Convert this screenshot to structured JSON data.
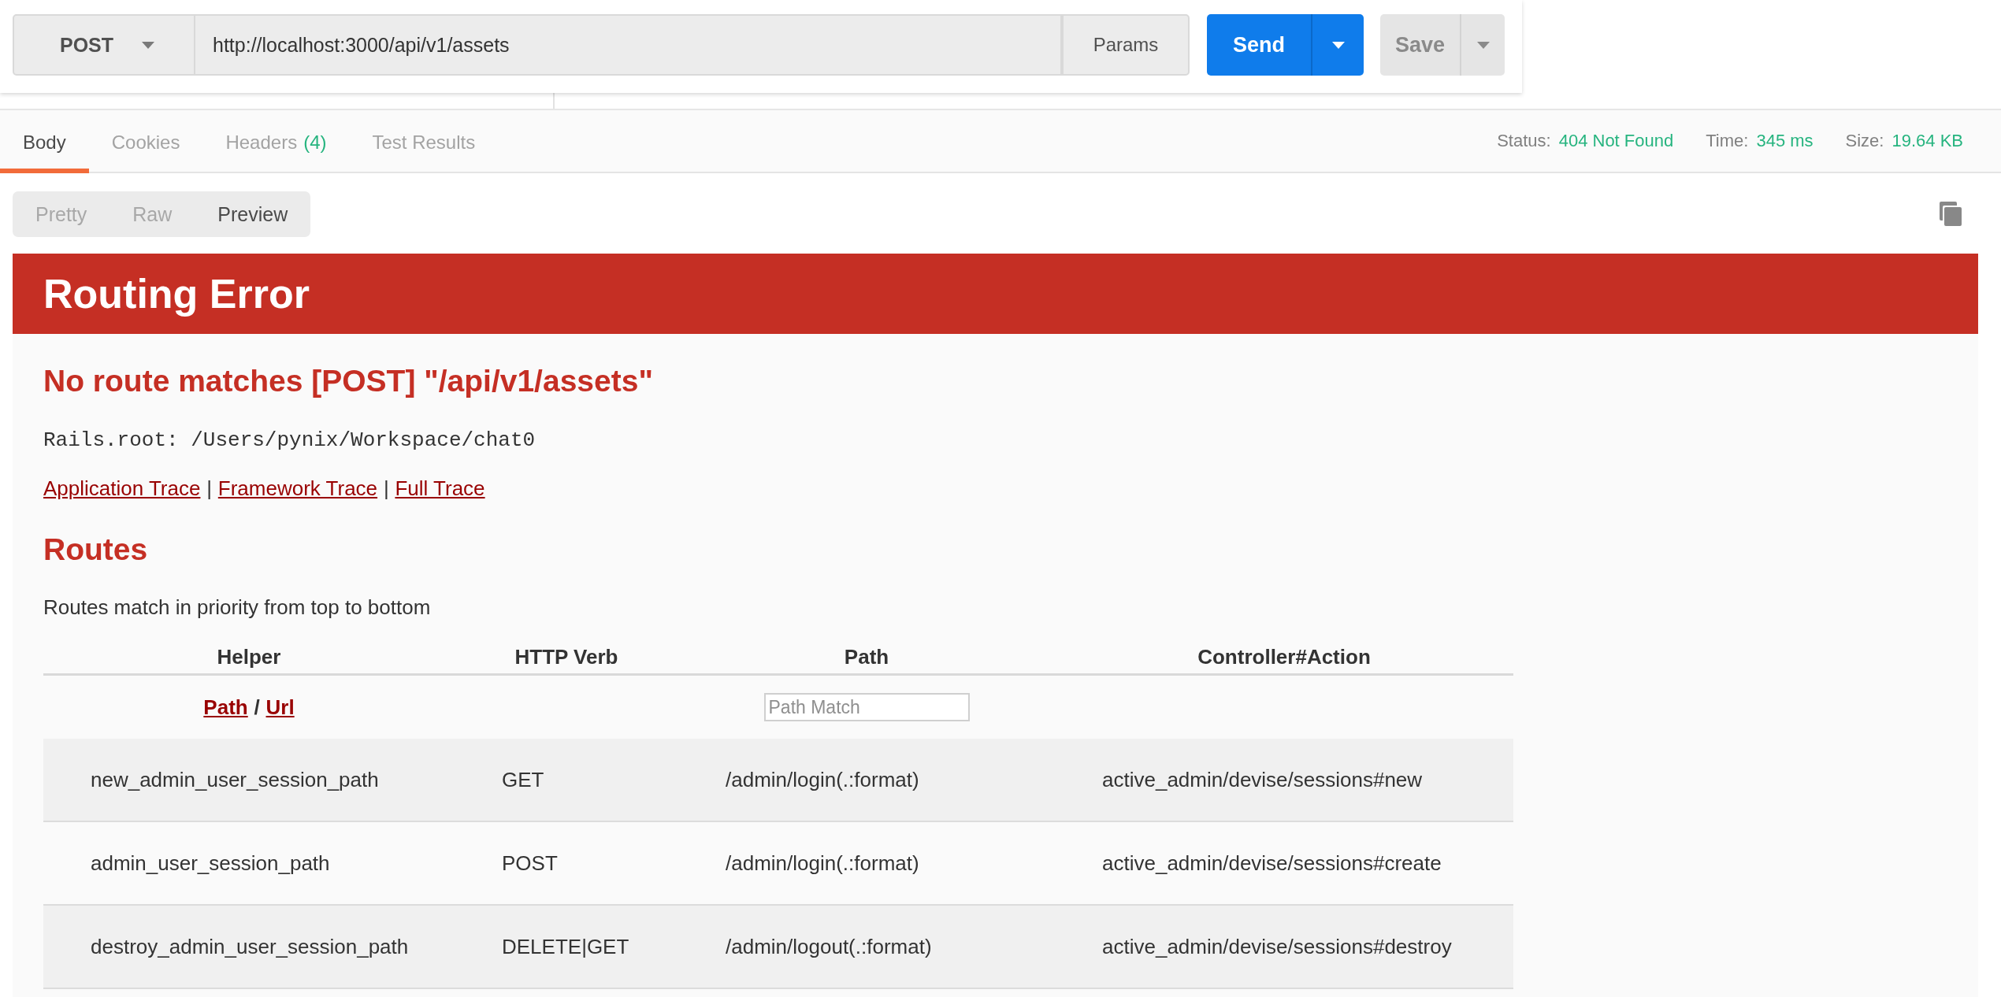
{
  "request": {
    "method": "POST",
    "url": "http://localhost:3000/api/v1/assets",
    "params": "Params",
    "send": "Send",
    "save": "Save"
  },
  "response_tabs": [
    {
      "label": "Body",
      "selected": true
    },
    {
      "label": "Cookies",
      "selected": false
    },
    {
      "label": "Headers",
      "count": "(4)",
      "selected": false
    },
    {
      "label": "Test Results",
      "selected": false
    }
  ],
  "status": [
    {
      "label": "Status:",
      "value": "404 Not Found"
    },
    {
      "label": "Time:",
      "value": "345 ms"
    },
    {
      "label": "Size:",
      "value": "19.64 KB"
    }
  ],
  "view_modes": [
    {
      "label": "Pretty",
      "selected": false
    },
    {
      "label": "Raw",
      "selected": false
    },
    {
      "label": "Preview",
      "selected": true
    }
  ],
  "preview": {
    "title": "Routing Error",
    "message": "No route matches [POST] \"/api/v1/assets\"",
    "rails_root": "Rails.root: /Users/pynix/Workspace/chat0",
    "trace_links": [
      {
        "kind": "link",
        "text": "Application Trace"
      },
      {
        "kind": "separator",
        "text": "|"
      },
      {
        "kind": "link",
        "text": "Framework Trace"
      },
      {
        "kind": "separator",
        "text": "|"
      },
      {
        "kind": "link",
        "text": "Full Trace"
      }
    ],
    "routes_title": "Routes",
    "routes_note": "Routes match in priority from top to bottom",
    "routes_table": {
      "columns": [
        "Helper",
        "HTTP Verb",
        "Path",
        "Controller#Action"
      ],
      "filter": {
        "helper": [
          {
            "kind": "link",
            "text": "Path"
          },
          {
            "kind": "separator",
            "text": "/"
          },
          {
            "kind": "link",
            "text": "Url"
          }
        ],
        "path_placeholder": "Path Match"
      },
      "rows": [
        {
          "helper": "new_admin_user_session_path",
          "verb": "GET",
          "path": "/admin/login(.:format)",
          "action": "active_admin/devise/sessions#new"
        },
        {
          "helper": "admin_user_session_path",
          "verb": "POST",
          "path": "/admin/login(.:format)",
          "action": "active_admin/devise/sessions#create"
        },
        {
          "helper": "destroy_admin_user_session_path",
          "verb": "DELETE|GET",
          "path": "/admin/logout(.:format)",
          "action": "active_admin/devise/sessions#destroy"
        }
      ]
    }
  }
}
